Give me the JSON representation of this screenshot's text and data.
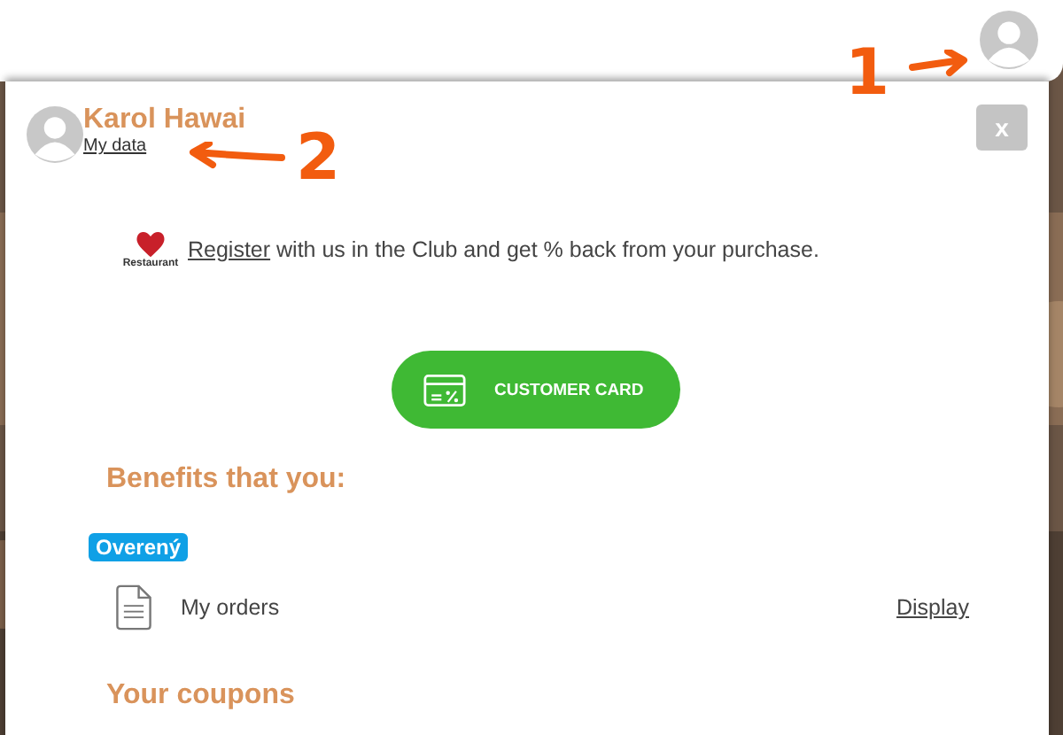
{
  "annotations": [
    {
      "label": "1"
    },
    {
      "label": "2"
    }
  ],
  "profile": {
    "name": "Karol Hawai",
    "link": "My data",
    "close": "x"
  },
  "club": {
    "logo_text": "Restaurant",
    "link": "Register",
    "text": " with us in the Club and get % back from your purchase."
  },
  "card_button": "CUSTOMER CARD",
  "benefits": {
    "title": "Benefits that you:",
    "badge": "Overený",
    "rows": [
      {
        "label": "My orders",
        "action": "Display"
      }
    ]
  },
  "coupons": {
    "title": "Your coupons"
  }
}
